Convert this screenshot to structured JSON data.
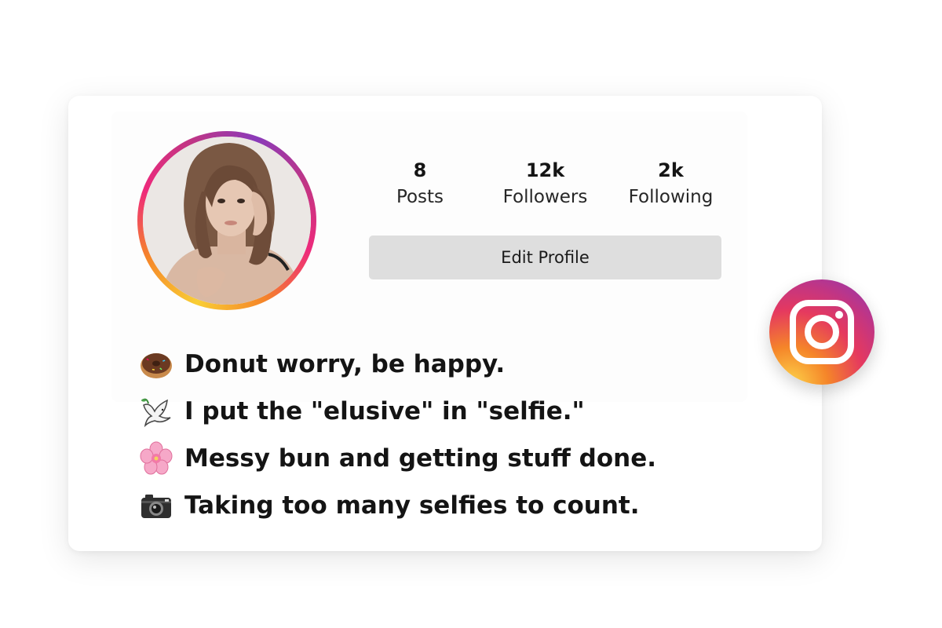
{
  "profile": {
    "stats": {
      "posts": {
        "value": "8",
        "label": "Posts"
      },
      "followers": {
        "value": "12k",
        "label": "Followers"
      },
      "following": {
        "value": "2k",
        "label": "Following"
      }
    },
    "edit_button_label": "Edit Profile"
  },
  "bio": [
    {
      "icon": "donut-icon",
      "text": "Donut worry, be happy."
    },
    {
      "icon": "dove-icon",
      "text": "I put the \"elusive\" in \"selfie.\""
    },
    {
      "icon": "cherry-blossom-icon",
      "text": "Messy bun and getting stuff done."
    },
    {
      "icon": "camera-icon",
      "text": "Taking too many selfies to count."
    }
  ],
  "colors": {
    "ring_gradient": [
      "#f9ce34",
      "#ee2a7b",
      "#8a3ab9"
    ],
    "button_bg": "#dedede",
    "text": "#141414"
  },
  "badge": {
    "icon": "instagram-icon"
  }
}
